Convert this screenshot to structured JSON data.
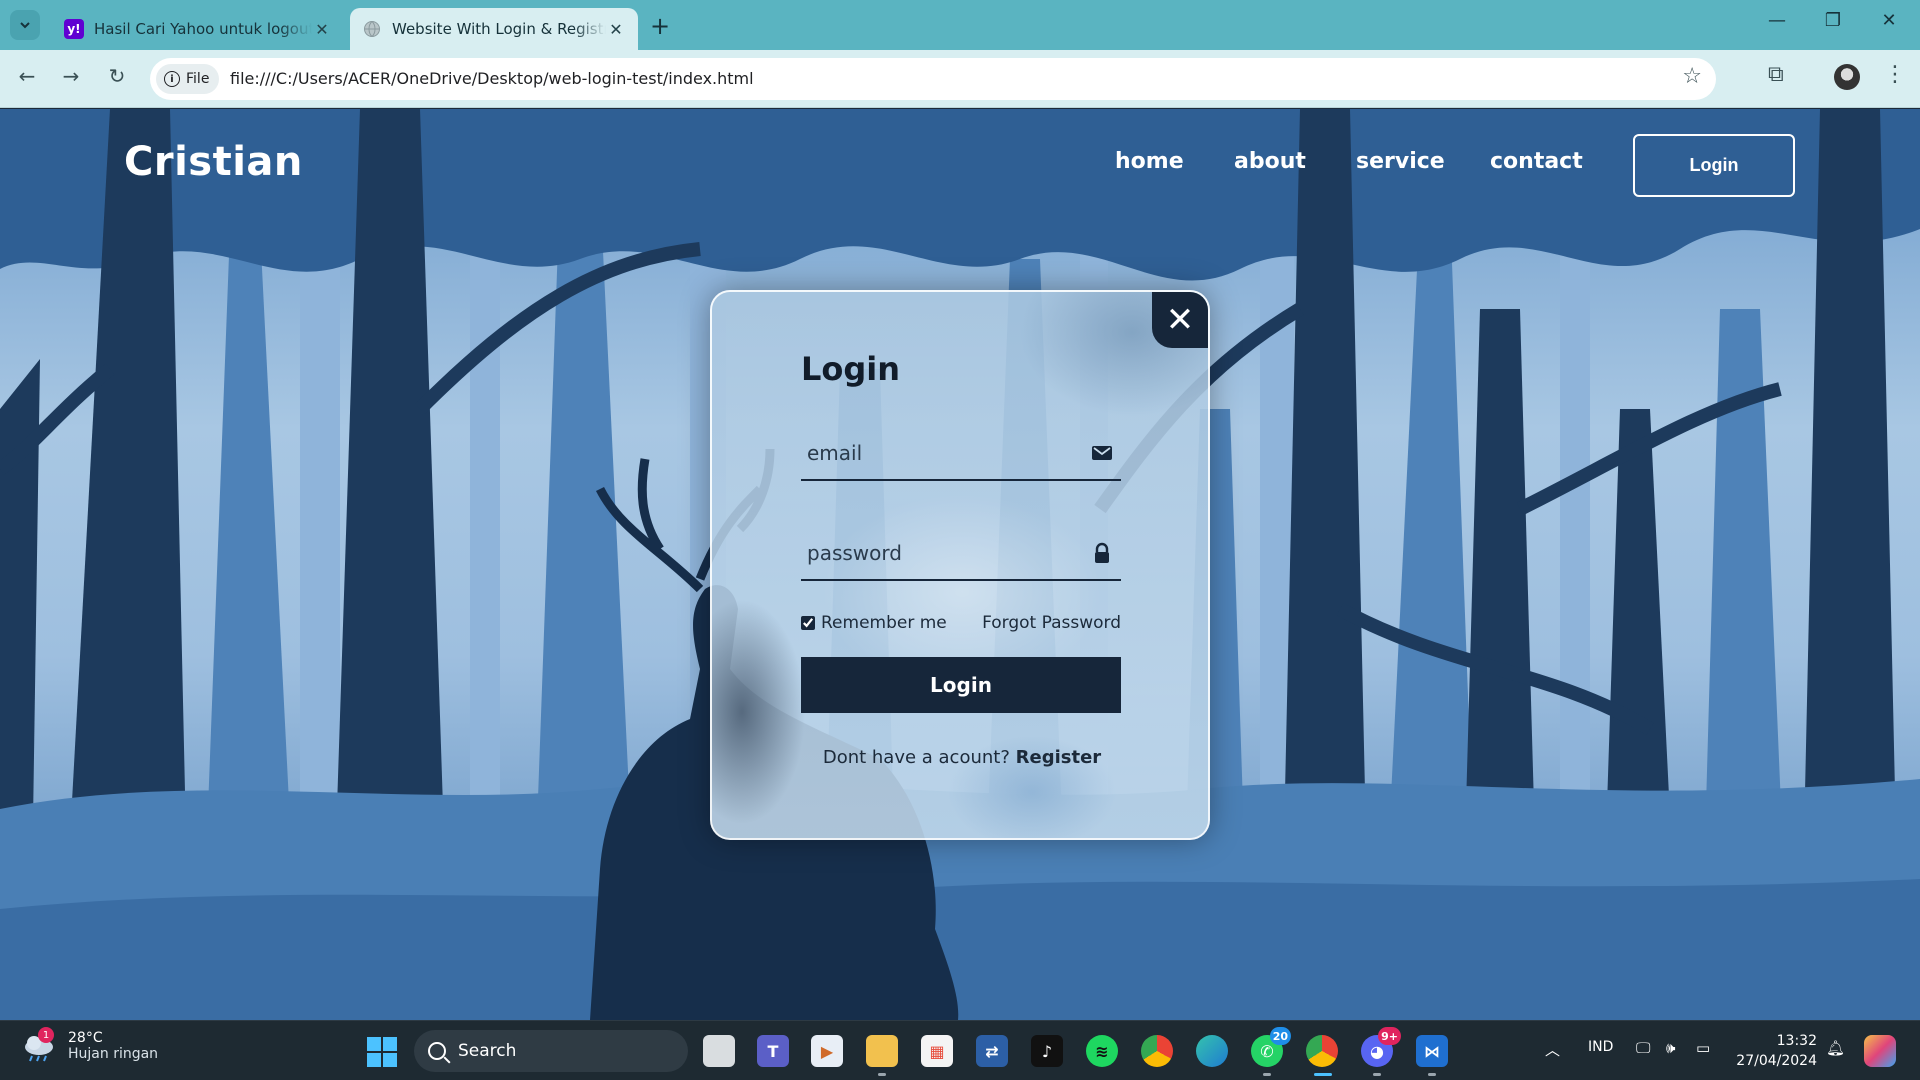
{
  "browser": {
    "tabs": [
      {
        "title": "Hasil Cari Yahoo untuk logout b",
        "favicon": "yahoo-icon",
        "active": false
      },
      {
        "title": "Website With Login & Registrat",
        "favicon": "globe-icon",
        "active": true
      }
    ],
    "address_chip": "File",
    "url": "file:///C:/Users/ACER/OneDrive/Desktop/web-login-test/index.html"
  },
  "site": {
    "logo": "Cristian",
    "nav": [
      "home",
      "about",
      "service",
      "contact"
    ],
    "login_button": "Login"
  },
  "login_modal": {
    "title": "Login",
    "email_placeholder": "email",
    "password_placeholder": "password",
    "remember_label": "Remember me",
    "remember_checked": true,
    "forgot_label": "Forgot Password",
    "submit_label": "Login",
    "register_prompt": "Dont have a acount?",
    "register_link": "Register",
    "close_glyph": "✕"
  },
  "taskbar": {
    "weather_temp": "28°C",
    "weather_desc": "Hujan ringan",
    "weather_badge": "1",
    "search_label": "Search",
    "whatsapp_count": "20",
    "discord_count": "9+",
    "language": "IND",
    "time": "13:32",
    "date": "27/04/2024"
  },
  "colors": {
    "accent_dark": "#16263a",
    "tabstrip": "#5ab4c1",
    "toolbar": "#d8eef1"
  }
}
